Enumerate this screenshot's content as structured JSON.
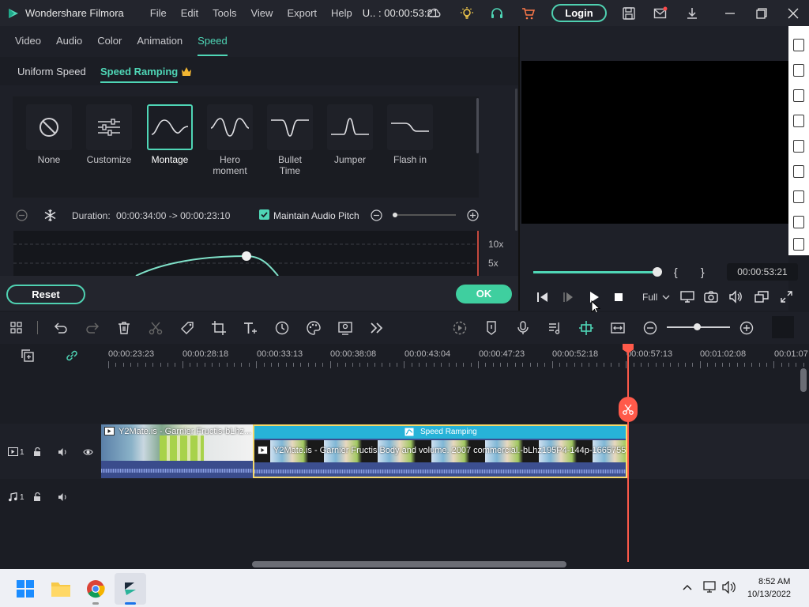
{
  "titlebar": {
    "app_name": "Wondershare Filmora",
    "menu": [
      "File",
      "Edit",
      "Tools",
      "View",
      "Export",
      "Help"
    ],
    "project": "U.. : 00:00:53:21",
    "login_label": "Login"
  },
  "panel_tabs": [
    "Video",
    "Audio",
    "Color",
    "Animation",
    "Speed"
  ],
  "active_tab": "Speed",
  "sub_tabs": {
    "uniform": "Uniform Speed",
    "ramping": "Speed Ramping"
  },
  "presets": [
    {
      "label": "None",
      "icon": "none-icon"
    },
    {
      "label": "Customize",
      "icon": "sliders-icon"
    },
    {
      "label": "Montage",
      "icon": "montage-curve-icon",
      "active": true
    },
    {
      "label": "Hero moment",
      "icon": "hero-curve-icon"
    },
    {
      "label": "Bullet Time",
      "icon": "bullet-curve-icon"
    },
    {
      "label": "Jumper",
      "icon": "jumper-curve-icon"
    },
    {
      "label": "Flash in",
      "icon": "flash-curve-icon"
    }
  ],
  "duration": {
    "label": "Duration:",
    "value": "00:00:34:00 -> 00:00:23:10",
    "maintain_pitch_label": "Maintain Audio Pitch",
    "maintain_pitch": true
  },
  "graph": {
    "labels": [
      "10x",
      "5x"
    ]
  },
  "buttons": {
    "reset": "Reset",
    "ok": "OK"
  },
  "player": {
    "timecode": "00:00:53:21",
    "quality": "Full",
    "mark_in": "{",
    "mark_out": "}",
    "progress": 1.0
  },
  "timeline": {
    "ruler": [
      "00:00:23:23",
      "00:00:28:18",
      "00:00:33:13",
      "00:00:38:08",
      "00:00:43:04",
      "00:00:47:23",
      "00:00:52:18",
      "00:00:57:13",
      "00:01:02:08",
      "00:01:07"
    ],
    "video_track_label": "1",
    "audio_track_label": "1",
    "clip1_title": "Y2Mate.is - Garnier Fructis-bLhz...",
    "clip2_effect": "Speed Ramping",
    "clip2_title": "Y2Mate.is - Garnier Fructis Body and volume. 2007 commercial.-bLhz195P4-144p-1665755..."
  },
  "taskbar": {
    "time": "8:52 AM",
    "date": "10/13/2022"
  },
  "colors": {
    "accent": "#4fd6b6",
    "playhead": "#ff5a4a",
    "clip_selected_border": "#f5d96b"
  }
}
